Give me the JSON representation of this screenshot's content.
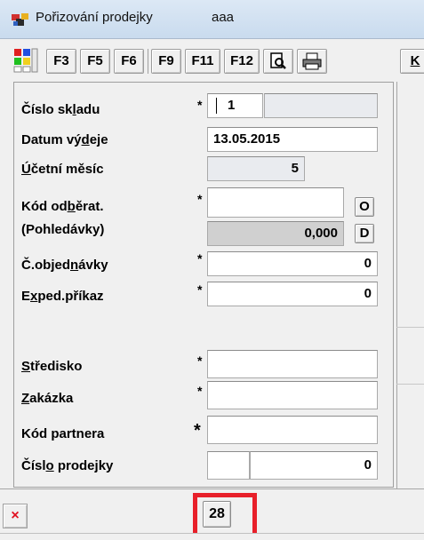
{
  "window": {
    "title": "Pořizování prodejky",
    "subtitle": "aaa"
  },
  "toolbar": {
    "buttons": [
      {
        "label": "F3"
      },
      {
        "label": "F5"
      },
      {
        "label": "F6"
      },
      {
        "label": "F9"
      },
      {
        "label": "F11"
      },
      {
        "label": "F12"
      }
    ],
    "icons": [
      "preview-icon",
      "print-icon"
    ],
    "last_label": "K"
  },
  "form": {
    "cislo_skladu": {
      "label_pre": "Číslo sk",
      "label_u": "l",
      "label_post": "adu",
      "required": "*",
      "value": "1"
    },
    "datum_vydeje": {
      "label_pre": "Datum vý",
      "label_u": "d",
      "label_post": "eje",
      "value": "13.05.2015"
    },
    "ucetni_mesic": {
      "label_u": "Ú",
      "label_post": "četní měsíc",
      "value": "5"
    },
    "kod_odberat": {
      "label_pre": "Kód od",
      "label_u": "b",
      "label_post": "ěrat.",
      "required": "*",
      "value": "",
      "button": "O"
    },
    "pohledavky": {
      "label": "(Pohledávky)",
      "value": "0,000",
      "button": "D"
    },
    "cislo_objednavky": {
      "label_pre": "Č.objed",
      "label_u": "n",
      "label_post": "ávky",
      "required": "*",
      "value": "0"
    },
    "exped_prikaz": {
      "label_pre": "E",
      "label_u": "x",
      "label_post": "ped.příkaz",
      "required": "*",
      "value": "0"
    },
    "stredisko": {
      "label_u": "S",
      "label_post": "tředisko",
      "required": "*",
      "value": ""
    },
    "zakazka": {
      "label_u": "Z",
      "label_post": "akázka",
      "required": "*",
      "value": ""
    },
    "kod_partnera": {
      "label": "Kód partnera",
      "required": "*",
      "value": ""
    },
    "cislo_prodejky": {
      "label_pre": "Čísl",
      "label_u": "o",
      "label_post": " prodejky",
      "value_left": "",
      "value": "0"
    }
  },
  "bottom": {
    "close_symbol": "×",
    "count": "28",
    "highlight_color": "#e8202a"
  }
}
